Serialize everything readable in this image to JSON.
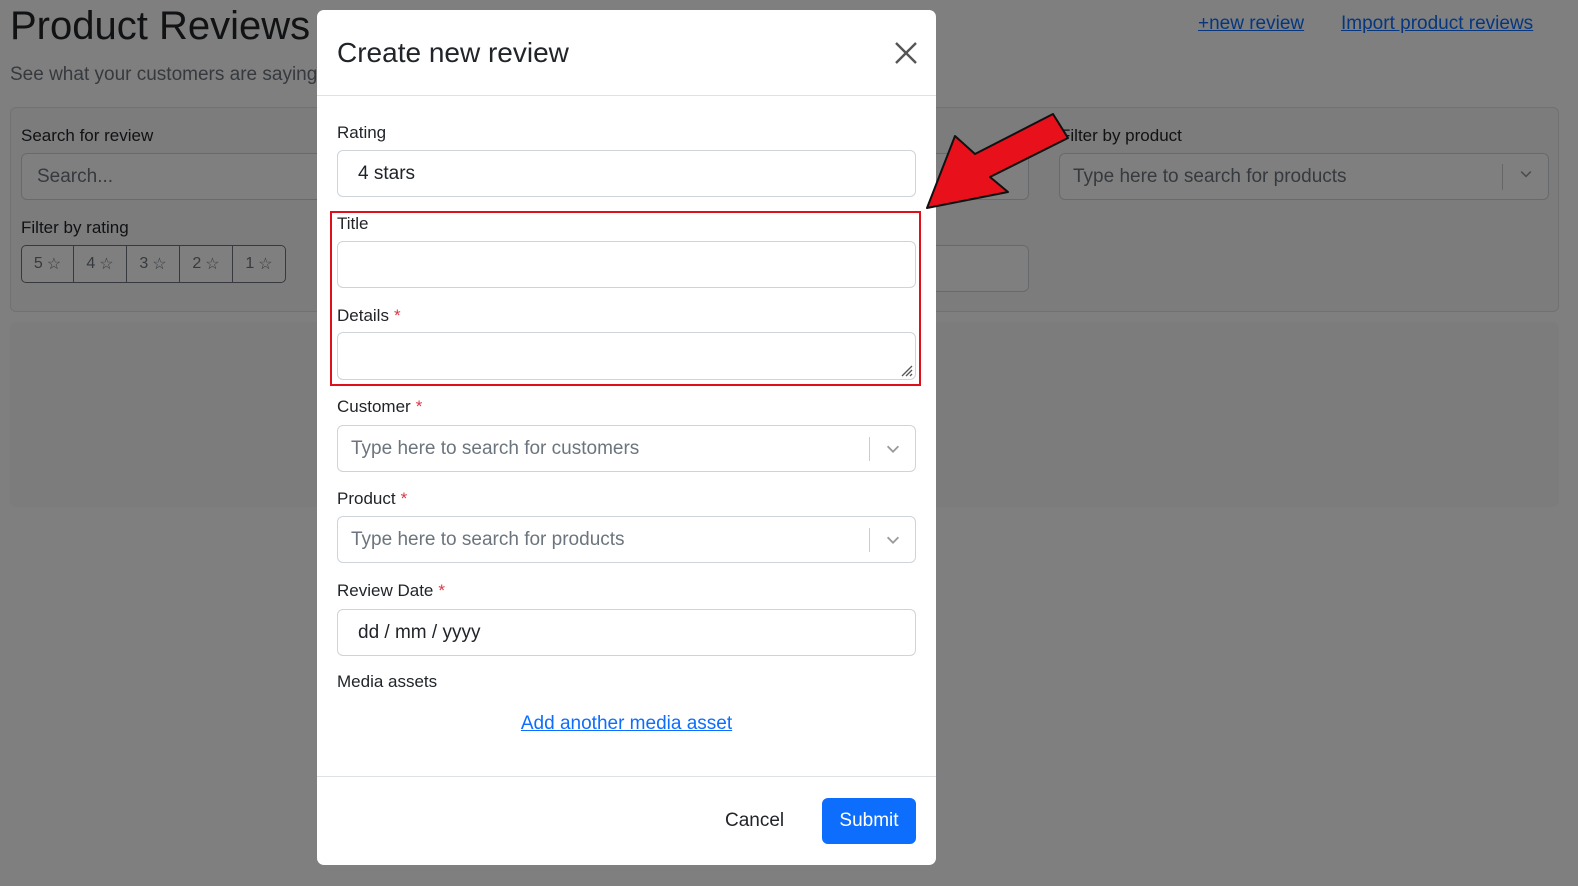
{
  "page": {
    "title": "Product Reviews",
    "subtitle": "See what your customers are saying",
    "links": {
      "new_review": "+new review",
      "import_reviews": "Import product reviews"
    }
  },
  "filters": {
    "search_label": "Search for review",
    "search_placeholder": "Search...",
    "product_label": "Filter by product",
    "product_placeholder": "Type here to search for products",
    "rating_label": "Filter by rating",
    "rating_buttons": [
      "5",
      "4",
      "3",
      "2",
      "1"
    ]
  },
  "modal": {
    "title": "Create new review",
    "fields": {
      "rating": {
        "label": "Rating",
        "value": "4 stars"
      },
      "title": {
        "label": "Title",
        "value": ""
      },
      "details": {
        "label": "Details",
        "required_mark": "*"
      },
      "customer": {
        "label": "Customer",
        "required_mark": "*",
        "placeholder": "Type here to search for customers"
      },
      "product": {
        "label": "Product",
        "required_mark": "*",
        "placeholder": "Type here to search for products"
      },
      "review_date": {
        "label": "Review Date",
        "required_mark": "*",
        "value": "dd / mm / yyyy"
      },
      "media_assets": {
        "label": "Media assets",
        "add_link": "Add another media asset"
      }
    },
    "buttons": {
      "cancel": "Cancel",
      "submit": "Submit"
    }
  },
  "colors": {
    "accent": "#0d6efd",
    "required": "#dc3545",
    "annotation": "#e0101b"
  }
}
